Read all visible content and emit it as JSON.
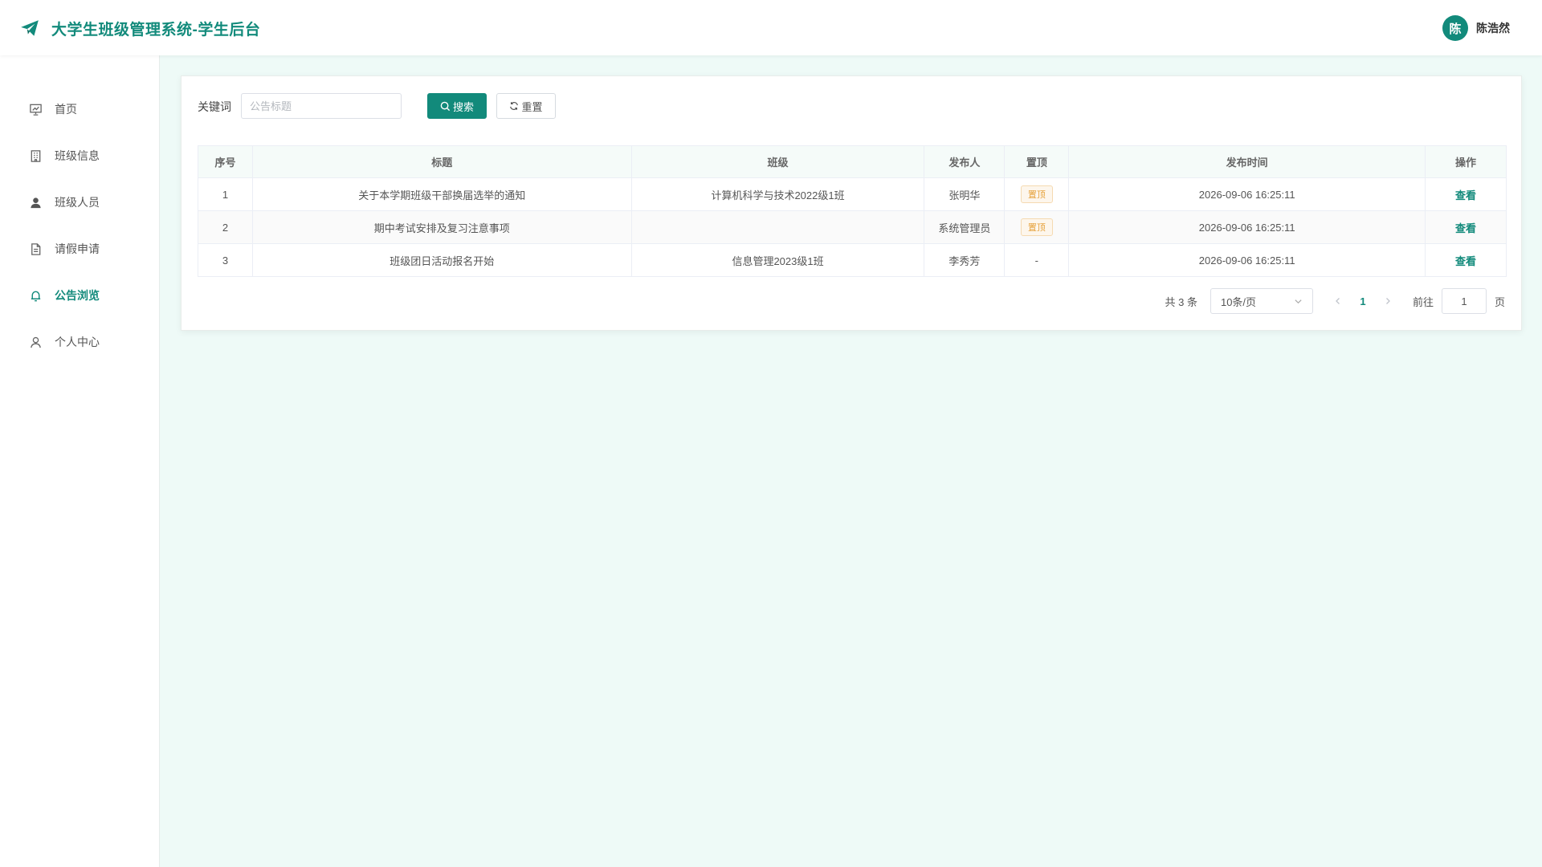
{
  "header": {
    "title": "大学生班级管理系统-学生后台",
    "user": {
      "avatar_text": "陈",
      "name": "陈浩然"
    }
  },
  "sidebar": {
    "items": [
      {
        "label": "首页",
        "icon": "home-chart-icon",
        "active": false
      },
      {
        "label": "班级信息",
        "icon": "building-icon",
        "active": false
      },
      {
        "label": "班级人员",
        "icon": "user-filled-icon",
        "active": false
      },
      {
        "label": "请假申请",
        "icon": "document-icon",
        "active": false
      },
      {
        "label": "公告浏览",
        "icon": "bell-icon",
        "active": true
      },
      {
        "label": "个人中心",
        "icon": "user-outline-icon",
        "active": false
      }
    ]
  },
  "search": {
    "label": "关键词",
    "placeholder": "公告标题",
    "value": "",
    "search_label": "搜索",
    "reset_label": "重置"
  },
  "table": {
    "columns": [
      "序号",
      "标题",
      "班级",
      "发布人",
      "置顶",
      "发布时间",
      "操作"
    ],
    "rows": [
      {
        "index": "1",
        "title": "关于本学期班级干部换届选举的通知",
        "class": "计算机科学与技术2022级1班",
        "publisher": "张明华",
        "pinned": "置顶",
        "time": "2026-09-06 16:25:11",
        "action": "查看"
      },
      {
        "index": "2",
        "title": "期中考试安排及复习注意事项",
        "class": "",
        "publisher": "系统管理员",
        "pinned": "置顶",
        "time": "2026-09-06 16:25:11",
        "action": "查看"
      },
      {
        "index": "3",
        "title": "班级团日活动报名开始",
        "class": "信息管理2023级1班",
        "publisher": "李秀芳",
        "pinned": "-",
        "time": "2026-09-06 16:25:11",
        "action": "查看"
      }
    ]
  },
  "pagination": {
    "total_text": "共 3 条",
    "page_size": "10条/页",
    "current_page": "1",
    "goto_label": "前往",
    "goto_value": "1",
    "page_unit": "页"
  },
  "colors": {
    "primary": "#128a7b",
    "background": "#eefaf7",
    "tag_warning": "#e6a23c"
  }
}
